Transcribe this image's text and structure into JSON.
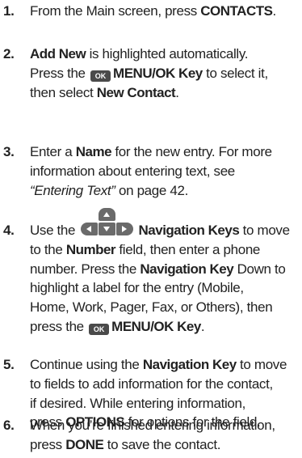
{
  "steps": [
    {
      "number": "1.",
      "lines": [
        [
          {
            "t": "From the Main screen, press "
          },
          {
            "t": "CONTACTS",
            "b": true
          },
          {
            "t": "."
          }
        ]
      ]
    },
    {
      "number": "2.",
      "lines": [
        [
          {
            "t": "Add New",
            "b": true
          },
          {
            "t": " is highlighted automatically."
          }
        ],
        [
          {
            "t": "Press the "
          },
          {
            "icon": "ok-key-icon",
            "label": "OK"
          },
          {
            "t": "MENU/OK Key",
            "b": true
          },
          {
            "t": " to select it,"
          }
        ],
        [
          {
            "t": "then select "
          },
          {
            "t": "New Contact",
            "b": true
          },
          {
            "t": "."
          }
        ]
      ]
    },
    {
      "number": "3.",
      "lines": [
        [
          {
            "t": "Enter a "
          },
          {
            "t": "Name",
            "b": true
          },
          {
            "t": " for the new entry. For more"
          }
        ],
        [
          {
            "t": "information about entering text, see"
          }
        ],
        [
          {
            "t": "“Entering Text”",
            "i": true
          },
          {
            "t": " on page 42."
          }
        ]
      ]
    },
    {
      "number": "4.",
      "lines": [
        [
          {
            "t": "Use the "
          },
          {
            "icon": "navigation-keys-icon"
          },
          {
            "t": "Navigation Keys",
            "b": true
          },
          {
            "t": " to move"
          }
        ],
        [
          {
            "t": "to the "
          },
          {
            "t": "Number",
            "b": true
          },
          {
            "t": " field, then enter a phone"
          }
        ],
        [
          {
            "t": "number. Press the "
          },
          {
            "t": "Navigation Key",
            "b": true
          },
          {
            "t": " Down to"
          }
        ],
        [
          {
            "t": "highlight a label for the entry (Mobile,"
          }
        ],
        [
          {
            "t": "Home, Work, Pager, Fax, or Others), then"
          }
        ],
        [
          {
            "t": "press the "
          },
          {
            "icon": "ok-key-icon",
            "label": "OK"
          },
          {
            "t": "MENU/OK Key",
            "b": true
          },
          {
            "t": "."
          }
        ]
      ]
    },
    {
      "number": "5.",
      "lines": [
        [
          {
            "t": "Continue using the "
          },
          {
            "t": "Navigation Key",
            "b": true
          },
          {
            "t": " to move"
          }
        ],
        [
          {
            "t": "to fields to add information for the contact,"
          }
        ],
        [
          {
            "t": "if desired. While entering information,"
          }
        ],
        [
          {
            "t": "press "
          },
          {
            "t": "OPTIONS",
            "b": true
          },
          {
            "t": " for options for the field."
          }
        ]
      ]
    },
    {
      "number": "6.",
      "lines": [
        [
          {
            "t": "When you’re finished entering information,"
          }
        ],
        [
          {
            "t": "press "
          },
          {
            "t": "DONE",
            "b": true
          },
          {
            "t": " to save the contact."
          }
        ]
      ]
    }
  ]
}
